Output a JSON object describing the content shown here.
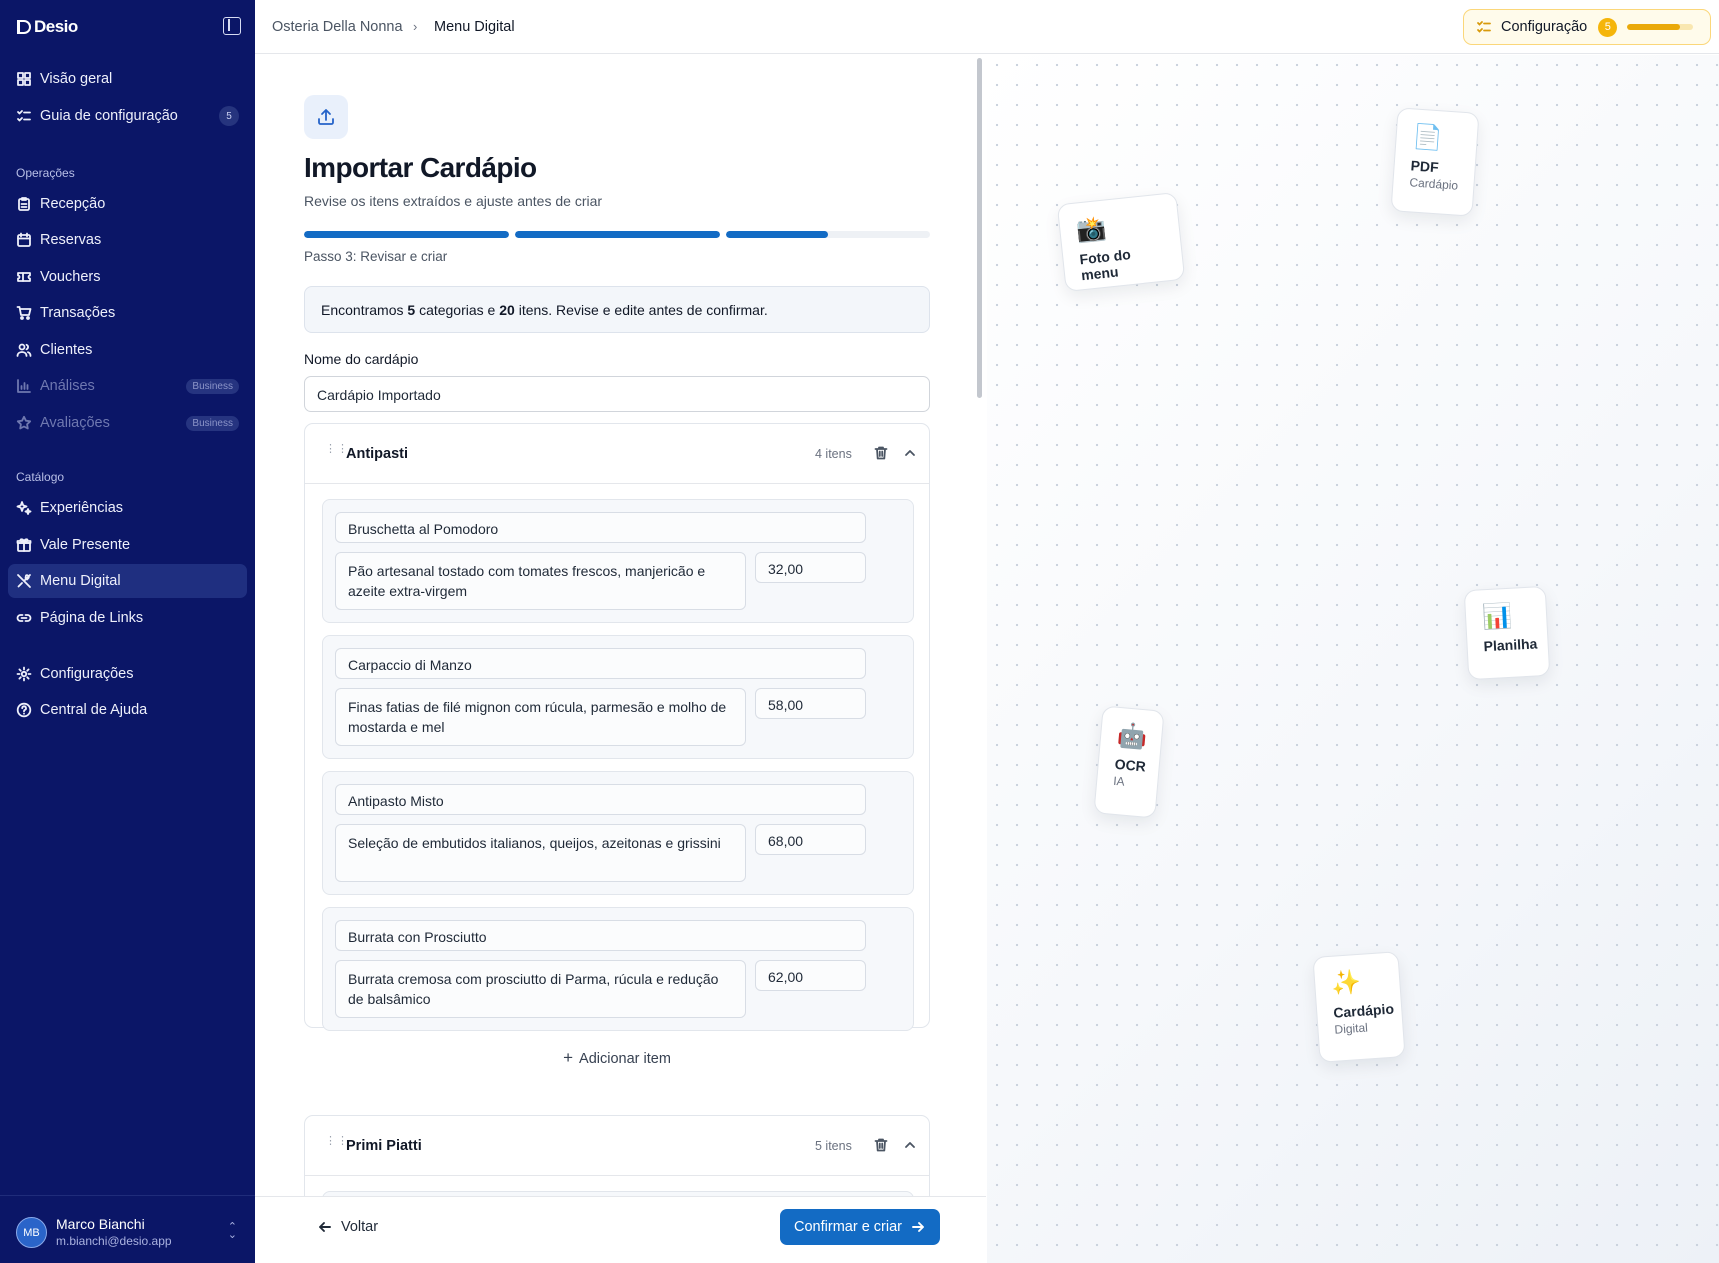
{
  "sidebar": {
    "brand": "Desio",
    "items": [
      {
        "label": "Visão geral",
        "icon": "dashboard-icon"
      },
      {
        "label": "Guia de configuração",
        "icon": "checklist-icon",
        "count": "5"
      }
    ],
    "sections": {
      "operacoes": "Operações",
      "catalogo": "Catálogo"
    },
    "operacoes_items": [
      {
        "label": "Recepção",
        "icon": "clipboard-icon"
      },
      {
        "label": "Reservas",
        "icon": "calendar-icon"
      },
      {
        "label": "Vouchers",
        "icon": "ticket-icon"
      },
      {
        "label": "Transações",
        "icon": "cart-icon"
      },
      {
        "label": "Clientes",
        "icon": "users-icon"
      },
      {
        "label": "Análises",
        "icon": "chart-icon",
        "badge": "Business"
      },
      {
        "label": "Avaliações",
        "icon": "star-icon",
        "badge": "Business"
      }
    ],
    "catalogo_items": [
      {
        "label": "Experiências",
        "icon": "sparkles-icon"
      },
      {
        "label": "Vale Presente",
        "icon": "gift-icon"
      },
      {
        "label": "Menu Digital",
        "icon": "utensils-icon",
        "active": true
      },
      {
        "label": "Página de Links",
        "icon": "link-icon"
      }
    ],
    "bottom_items": [
      {
        "label": "Configurações",
        "icon": "gear-icon"
      },
      {
        "label": "Central de Ajuda",
        "icon": "help-icon"
      }
    ],
    "user": {
      "initials": "MB",
      "name": "Marco Bianchi",
      "email": "m.bianchi@desio.app"
    }
  },
  "header": {
    "breadcrumb": [
      "Osteria Della Nonna",
      "Menu Digital"
    ],
    "config_label": "Configuração",
    "config_count": "5",
    "config_progress": 0.8
  },
  "main": {
    "title": "Importar Cardápio",
    "subtitle": "Revise os itens extraídos e ajuste antes de criar",
    "step_label": "Passo 3: Revisar e criar",
    "step_progress": [
      1,
      1,
      0.5
    ],
    "info": {
      "prefix": "Encontramos",
      "categories": "5",
      "mid": "categorias e",
      "items": "20",
      "suffix": "itens. Revise e edite antes de confirmar."
    },
    "name_label": "Nome do cardápio",
    "name_value": "Cardápio Importado",
    "categories": [
      {
        "name": "Antipasti",
        "count": "4 itens",
        "items": [
          {
            "name": "Bruschetta al Pomodoro",
            "desc": "Pão artesanal tostado com tomates frescos, manjericão e azeite extra-virgem",
            "price": "32,00"
          },
          {
            "name": "Carpaccio di Manzo",
            "desc": "Finas fatias de filé mignon com rúcula, parmesão e molho de mostarda e mel",
            "price": "58,00"
          },
          {
            "name": "Antipasto Misto",
            "desc": "Seleção de embutidos italianos, queijos, azeitonas e grissini",
            "price": "68,00"
          },
          {
            "name": "Burrata con Prosciutto",
            "desc": "Burrata cremosa com prosciutto di Parma, rúcula e redução de balsâmico",
            "price": "62,00"
          }
        ],
        "add_label": "Adicionar item"
      },
      {
        "name": "Primi Piatti",
        "count": "5 itens"
      }
    ]
  },
  "footer": {
    "back_label": "Voltar",
    "confirm_label": "Confirmar e criar"
  },
  "decor": {
    "cards": [
      {
        "emoji": "📄",
        "title": "PDF",
        "sub": "Cardápio"
      },
      {
        "emoji": "📸",
        "title": "Foto do menu",
        "sub": ""
      },
      {
        "emoji": "📊",
        "title": "Planilha",
        "sub": ""
      },
      {
        "emoji": "🤖",
        "title": "OCR",
        "sub": "IA"
      },
      {
        "emoji": "✨",
        "title": "Cardápio",
        "sub": "Digital"
      }
    ]
  }
}
